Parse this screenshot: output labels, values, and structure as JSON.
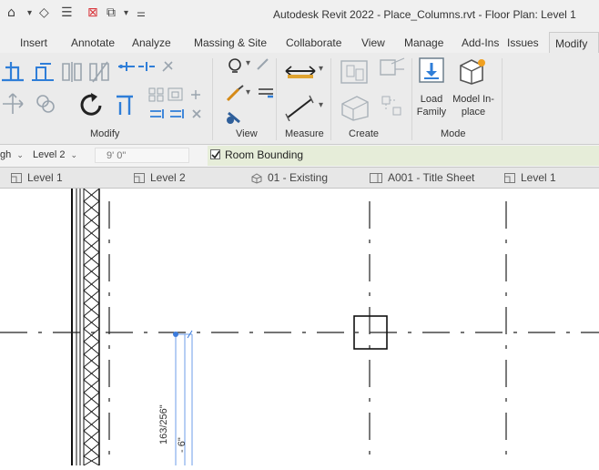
{
  "window": {
    "title": "Autodesk Revit 2022 - Place_Columns.rvt - Floor Plan: Level 1"
  },
  "ribbon_tabs": [
    {
      "label": "Insert"
    },
    {
      "label": "Annotate"
    },
    {
      "label": "Analyze"
    },
    {
      "label": "Massing & Site"
    },
    {
      "label": "Collaborate"
    },
    {
      "label": "View"
    },
    {
      "label": "Manage"
    },
    {
      "label": "Add-Ins"
    },
    {
      "label": "Issues"
    },
    {
      "label": "Modify"
    }
  ],
  "ribbon": {
    "panels": {
      "modify": "Modify",
      "view": "View",
      "measure": "Measure",
      "create": "Create",
      "mode": "Mode"
    },
    "buttons": {
      "load_family": "Load Family",
      "model_inplace": "Model In-place"
    }
  },
  "options_bar": {
    "height_mode": "gh",
    "level": "Level 2",
    "offset": "9' 0\"",
    "room_bounding": "Room Bounding",
    "room_bounding_checked": true
  },
  "view_tabs": [
    {
      "label": "Level 1",
      "icon": "floor-plan-icon"
    },
    {
      "label": "Level 2",
      "icon": "floor-plan-icon"
    },
    {
      "label": "01 - Existing",
      "icon": "3d-view-icon"
    },
    {
      "label": "A001 - Title Sheet",
      "icon": "sheet-icon"
    },
    {
      "label": "Level 1",
      "icon": "floor-plan-icon"
    }
  ],
  "canvas": {
    "dimension_text": "163/256\"",
    "dimension_text_2": "- 6\""
  },
  "colors": {
    "ribbon_bg": "#ebebeb",
    "room_bounding_highlight": "#e6edd9",
    "dimension_blue": "#3b7bdc",
    "grid_line": "#222222"
  }
}
